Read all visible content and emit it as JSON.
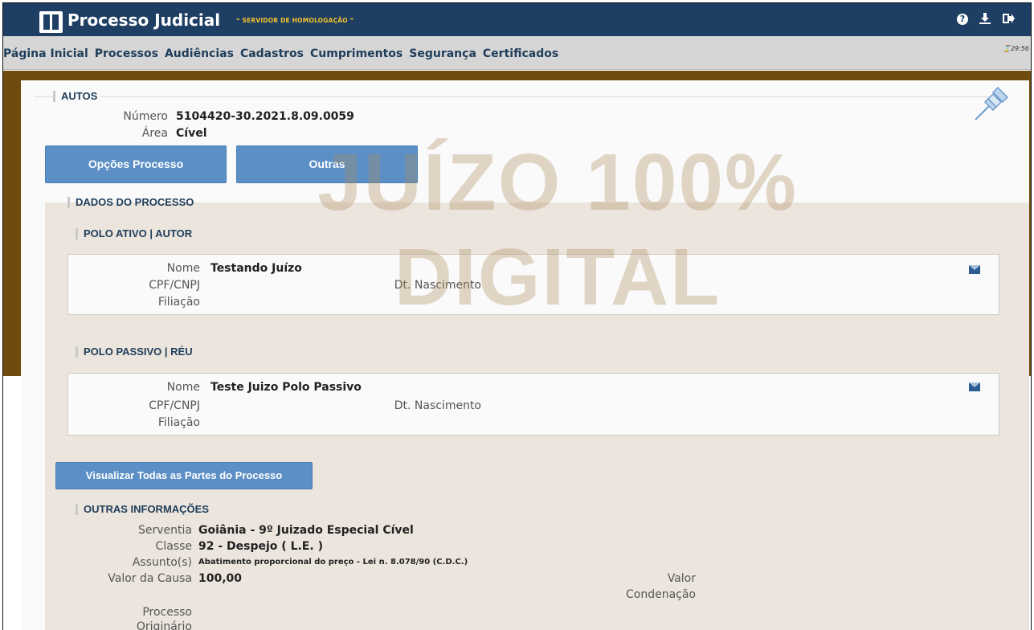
{
  "header": {
    "title": "Processo Judicial",
    "server_tag": "❝ SERVIDOR DE HOMOLOGAÇÃO ❞",
    "icons": [
      "help-icon",
      "download-icon",
      "logout-icon"
    ]
  },
  "menu": {
    "items": [
      "Página Inicial",
      "Processos",
      "Audiências",
      "Cadastros",
      "Cumprimentos",
      "Segurança",
      "Certificados"
    ],
    "timer": "29:56"
  },
  "autos": {
    "legend": "AUTOS",
    "numero_label": "Número",
    "numero_value": "5104420-30.2021.8.09.0059",
    "area_label": "Área",
    "area_value": "Cível"
  },
  "buttons": {
    "opcoes": "Opções Processo",
    "outras": "Outras",
    "visualizar": "Visualizar Todas as Partes do Processo"
  },
  "dados": {
    "legend": "DADOS DO PROCESSO"
  },
  "polo_ativo": {
    "legend": "POLO ATIVO | AUTOR",
    "nome_label": "Nome",
    "nome_value": "Testando Juízo",
    "cpf_label": "CPF/CNPJ",
    "nascimento_label": "Dt. Nascimento",
    "filiacao_label": "Filiação"
  },
  "polo_passivo": {
    "legend": "POLO PASSIVO | RÉU",
    "nome_label": "Nome",
    "nome_value": "Teste Juizo Polo Passivo",
    "cpf_label": "CPF/CNPJ",
    "nascimento_label": "Dt. Nascimento",
    "filiacao_label": "Filiação"
  },
  "outras_info": {
    "legend": "OUTRAS INFORMAÇÕES",
    "serventia_label": "Serventia",
    "serventia_value": "Goiânia - 9º Juizado Especial Cível",
    "classe_label": "Classe",
    "classe_value": "92 - Despejo ( L.E. )",
    "assunto_label": "Assunto(s)",
    "assunto_value": "Abatimento proporcional do preço - Lei n. 8.078/90 (C.D.C.)",
    "valor_causa_label": "Valor da Causa",
    "valor_causa_value": "100,00",
    "valor_cond_label_1": "Valor",
    "valor_cond_label_2": "Condenação",
    "proc_orig_label_1": "Processo",
    "proc_orig_label_2": "Originário"
  },
  "watermark": {
    "line1": "JUÍZO 100%",
    "line2": "DIGITAL"
  },
  "colors": {
    "header": "#1e3f63",
    "accent_button": "#5b8fc6",
    "highlight_frame": "#704b10",
    "server_tag": "#f2c12e"
  }
}
